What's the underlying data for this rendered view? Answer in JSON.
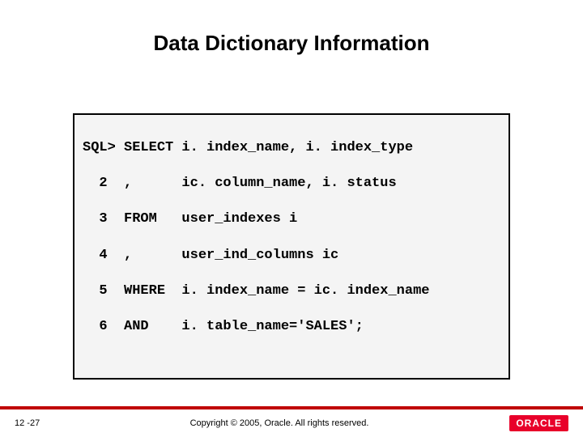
{
  "title": "Data Dictionary Information",
  "code": {
    "lines": [
      "SQL> SELECT i. index_name, i. index_type",
      "  2  ,      ic. column_name, i. status",
      "  3  FROM   user_indexes i",
      "  4  ,      user_ind_columns ic",
      "  5  WHERE  i. index_name = ic. index_name",
      "  6  AND    i. table_name='SALES';"
    ]
  },
  "footer": {
    "page": "12 -27",
    "copyright": "Copyright © 2005, Oracle. All rights reserved.",
    "brand": "ORACLE"
  },
  "colors": {
    "accent_red": "#c00000",
    "brand_red": "#e8002a"
  }
}
